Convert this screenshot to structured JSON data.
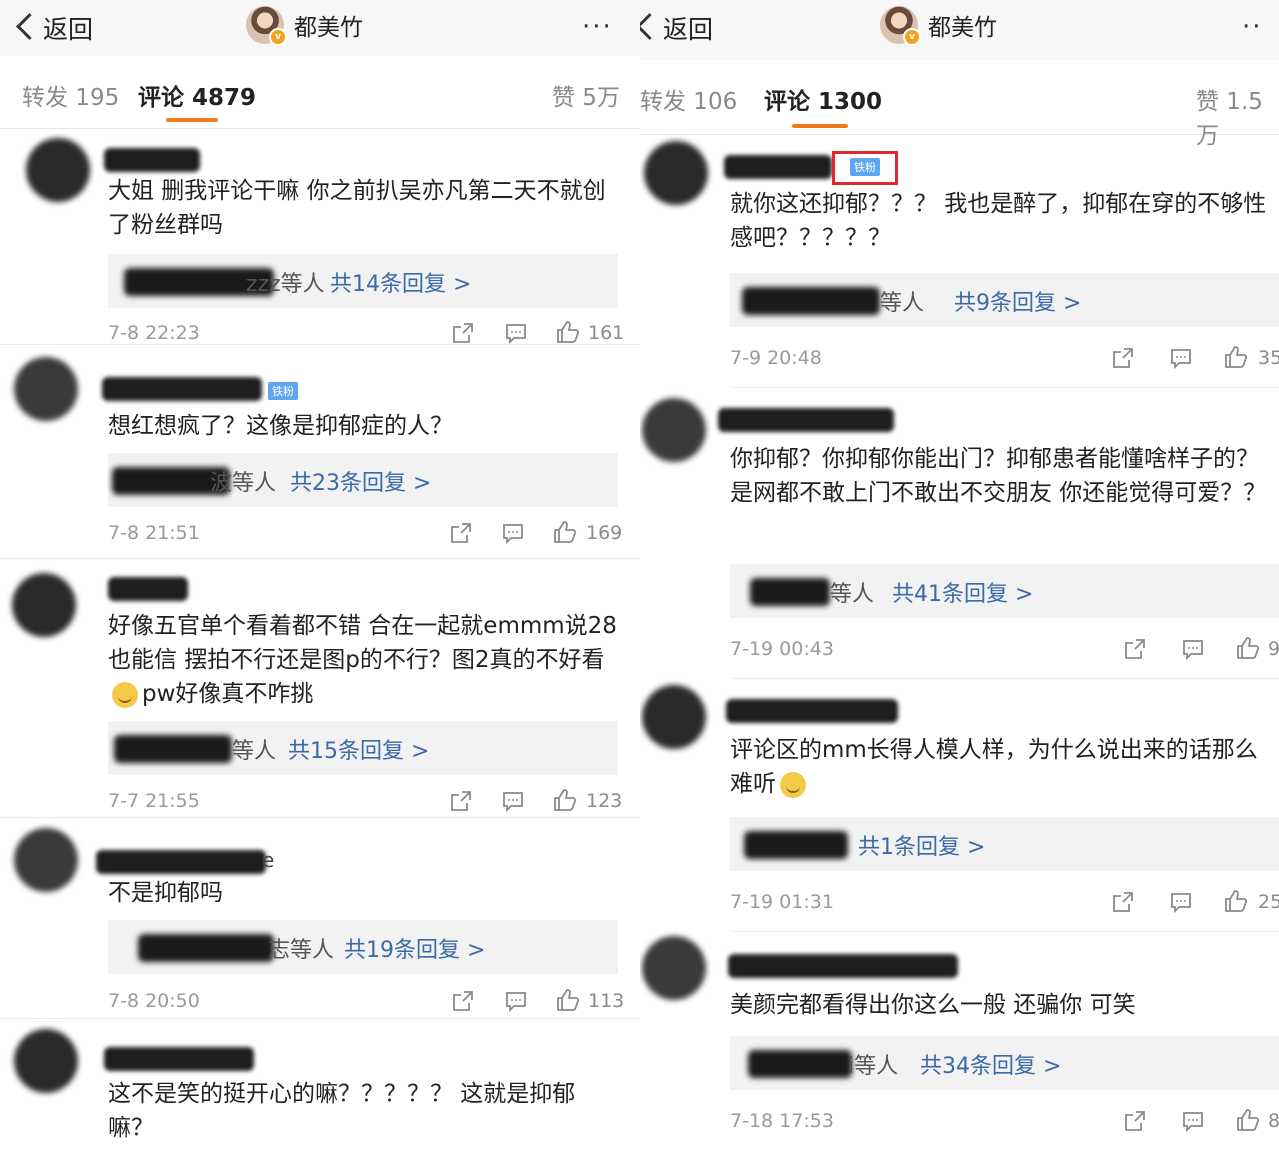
{
  "left": {
    "header": {
      "back_label": "返回",
      "profile_name": "都美竹",
      "more_label": "···"
    },
    "tabs": {
      "repost": "转发 195",
      "comments": "评论 4879",
      "likes": "赞 5万"
    },
    "comments": [
      {
        "text": "大姐 删我评论干嘛 你之前扒吴亦凡第二天不就创了粉丝群吗",
        "reply_who": "zzz等人",
        "reply_count": "共14条回复 >",
        "date": "7-8 22:23",
        "likes": "161"
      },
      {
        "badge": "铁粉",
        "text": "想红想疯了？这像是抑郁症的人？",
        "reply_who": "波等人",
        "reply_count": "共23条回复 >",
        "date": "7-8 21:51",
        "likes": "169"
      },
      {
        "text": "好像五官单个看着都不错 合在一起就emmm说28也能信 摆拍不行还是图p的不行？图2真的不好看",
        "text_tail": "pw好像真不咋挑",
        "reply_who": "等人",
        "reply_count": "共15条回复 >",
        "date": "7-7 21:55",
        "likes": "123"
      },
      {
        "user_tail": "e",
        "text": "不是抑郁吗",
        "reply_who": "志等人",
        "reply_count": "共19条回复 >",
        "date": "7-8 20:50",
        "likes": "113"
      },
      {
        "text": "这不是笑的挺开心的嘛？？？？？ 这就是抑郁嘛？"
      }
    ]
  },
  "right": {
    "header": {
      "back_label": "返回",
      "profile_name": "都美竹",
      "more_label": "··"
    },
    "tabs": {
      "repost": "转发 106",
      "comments": "评论 1300",
      "likes": "赞 1.5万"
    },
    "comments": [
      {
        "badge": "铁粉",
        "text": "就你这还抑郁？？？ 我也是醉了，抑郁在穿的不够性感吧？？？？？",
        "reply_who": "等人",
        "reply_count": "共9条回复 >",
        "date": "7-9 20:48",
        "likes": "35"
      },
      {
        "text": "你抑郁？你抑郁你能出门？抑郁患者能懂啥样子的？是网都不敢上门不敢出不交朋友 你还能觉得可爱？？",
        "reply_who": "等人",
        "reply_count": "共41条回复 >",
        "date": "7-19 00:43",
        "likes": "9"
      },
      {
        "text": "评论区的mm长得人模人样，为什么说出来的话那么难听",
        "reply_count": "共1条回复 >",
        "date": "7-19 01:31",
        "likes": "25"
      },
      {
        "text": "美颜完都看得出你这么一般 还骗你 可笑",
        "reply_who": "i等人",
        "reply_count": "共34条回复 >",
        "date": "7-18 17:53",
        "likes": "8"
      }
    ]
  },
  "colors": {
    "accent": "#f07a1a",
    "link": "#3b6aa8",
    "badge": "#5ea7f0",
    "highlight_box": "#e02a2a"
  }
}
